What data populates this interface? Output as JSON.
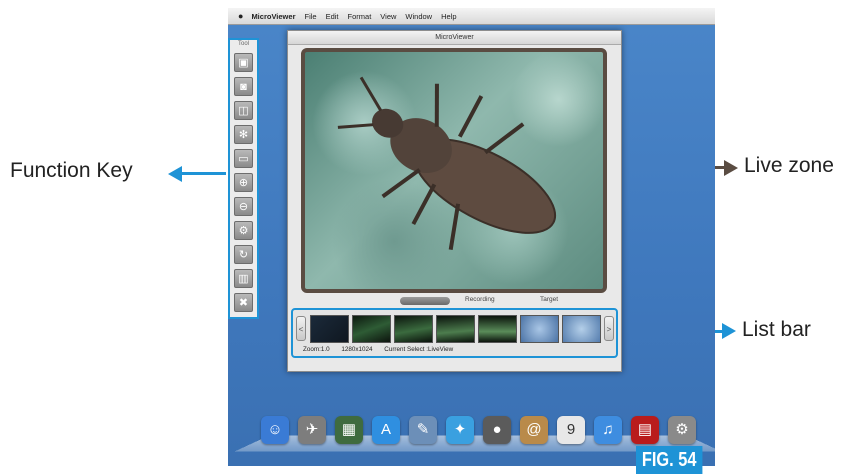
{
  "callouts": {
    "function_key": "Function Key",
    "live_zone": "Live zone",
    "list_bar": "List bar"
  },
  "menubar": {
    "apple_icon": "apple-icon",
    "app_name": "MicroViewer",
    "items": [
      "File",
      "Edit",
      "Format",
      "View",
      "Window",
      "Help"
    ]
  },
  "tool_panel": {
    "title": "Tool",
    "buttons": [
      {
        "name": "snapshot-icon",
        "glyph": "▣"
      },
      {
        "name": "video-camera-icon",
        "glyph": "◙"
      },
      {
        "name": "compare-icon",
        "glyph": "◫"
      },
      {
        "name": "freeze-icon",
        "glyph": "✻"
      },
      {
        "name": "measure-icon",
        "glyph": "▭"
      },
      {
        "name": "zoom-in-icon",
        "glyph": "⊕"
      },
      {
        "name": "zoom-out-icon",
        "glyph": "⊖"
      },
      {
        "name": "settings-icon",
        "glyph": "⚙"
      },
      {
        "name": "rotate-icon",
        "glyph": "↻"
      },
      {
        "name": "trash-icon",
        "glyph": "▥"
      },
      {
        "name": "close-icon",
        "glyph": "✖"
      }
    ]
  },
  "window": {
    "title": "MicroViewer",
    "tab_recording": "Recording",
    "tab_target": "Target",
    "scroll_left": "<",
    "scroll_right": ">",
    "status": {
      "zoom": "Zoom:1.0",
      "resolution": "1280x1024",
      "current_select": "Current Select :LiveView"
    }
  },
  "dock": {
    "icons": [
      {
        "name": "finder-icon",
        "color": "#3a7bd5",
        "glyph": "☺"
      },
      {
        "name": "launchpad-icon",
        "color": "#7d7d7d",
        "glyph": "✈"
      },
      {
        "name": "mission-control-icon",
        "color": "#3f6b3f",
        "glyph": "▦"
      },
      {
        "name": "app-store-icon",
        "color": "#2f8fe0",
        "glyph": "A"
      },
      {
        "name": "preview-icon",
        "color": "#6c8fb8",
        "glyph": "✎"
      },
      {
        "name": "safari-icon",
        "color": "#3aa0e0",
        "glyph": "✦"
      },
      {
        "name": "facetime-icon",
        "color": "#5b5b5b",
        "glyph": "●"
      },
      {
        "name": "contacts-icon",
        "color": "#b98a4a",
        "glyph": "@"
      },
      {
        "name": "calendar-icon",
        "color": "#e8e8e8",
        "glyph": "9"
      },
      {
        "name": "itunes-icon",
        "color": "#3e8de0",
        "glyph": "♫"
      },
      {
        "name": "photo-booth-icon",
        "color": "#b91c1c",
        "glyph": "▤"
      },
      {
        "name": "system-preferences-icon",
        "color": "#8a8a8a",
        "glyph": "⚙"
      }
    ]
  },
  "figure_label": "FIG. 54",
  "colors": {
    "accent": "#1e93d6",
    "desktop": "#3f78bd"
  }
}
